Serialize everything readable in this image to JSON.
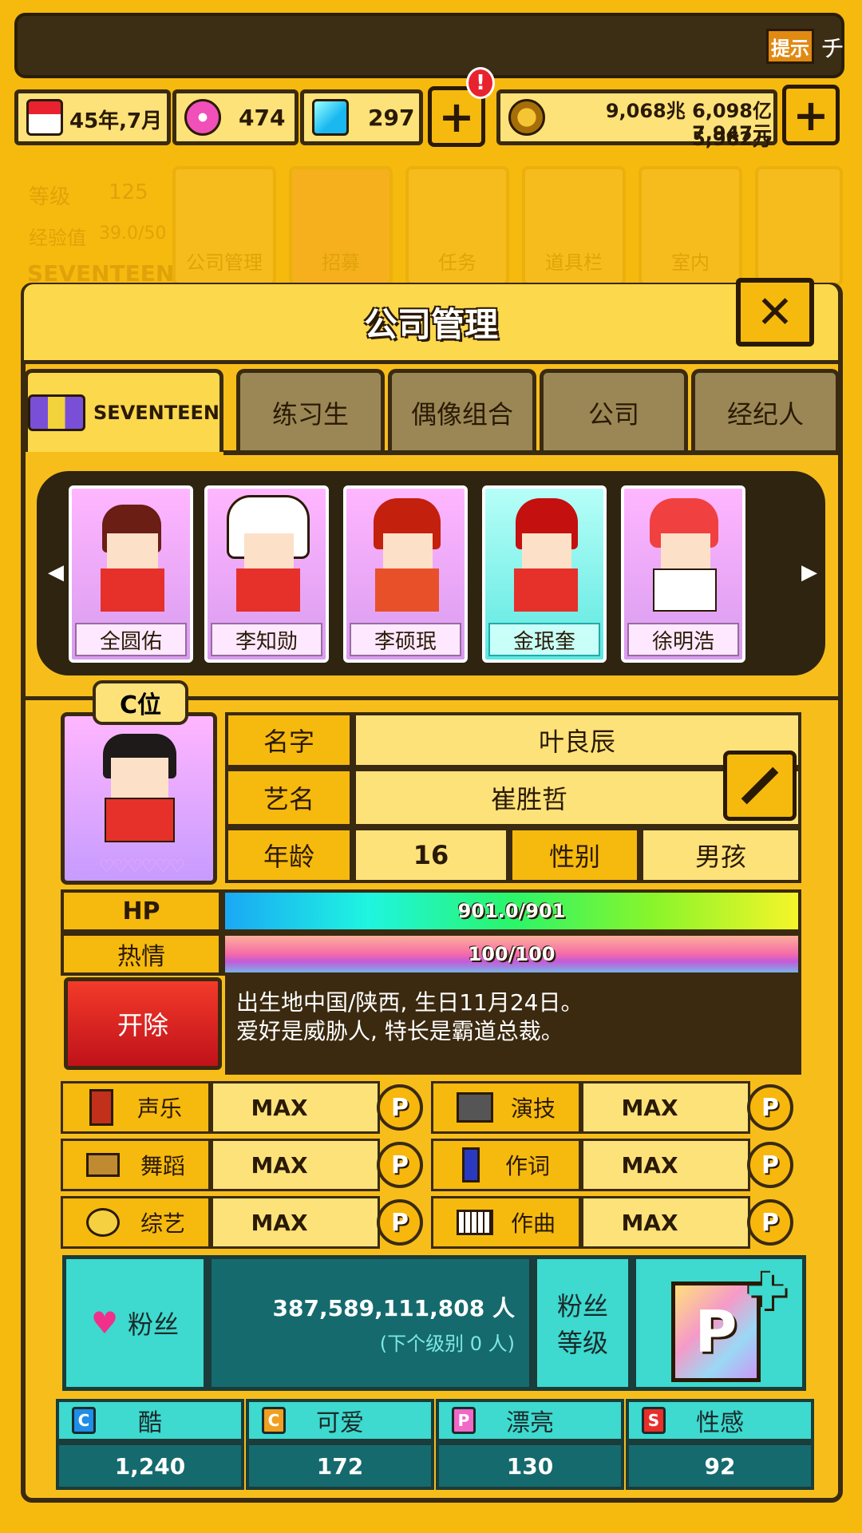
{
  "topbar": {
    "tip_label": "提示",
    "more_label": "チ",
    "date": "45年,7月",
    "gems_pink": "474",
    "gems_blue": "297",
    "money_line1": "9,068兆 6,098亿 5,962万",
    "money_line2": "7,947元",
    "alert_mark": "!"
  },
  "bg_menu": {
    "level_label": "等级",
    "level_value": "125",
    "exp_label": "经验值",
    "exp_value": "39.0/50",
    "group": "SEVENTEEN",
    "items": [
      "公司管理",
      "招募",
      "任务",
      "道具栏",
      "室内"
    ]
  },
  "panel": {
    "title": "公司管理",
    "close": "✕",
    "tabs": [
      "SEVENTEEN",
      "练习生",
      "偶像组合",
      "公司",
      "经纪人"
    ]
  },
  "members": [
    "全圆佑",
    "李知勋",
    "李硕珉",
    "金珉奎",
    "徐明浩"
  ],
  "profile": {
    "position": "C位",
    "name_label": "名字",
    "name_value": "叶良辰",
    "stage_label": "艺名",
    "stage_value": "崔胜哲",
    "age_label": "年龄",
    "age_value": "16",
    "gender_label": "性别",
    "gender_value": "男孩",
    "hearts": "♡♡♡♡♡♡",
    "hp_label": "HP",
    "hp_value": "901.0/901",
    "hp_fraction": 1.0,
    "passion_label": "热情",
    "passion_value": "100/100",
    "passion_fraction": 1.0,
    "fire_label": "开除",
    "bio_line1": "出生地中国/陕西, 生日11月24日。",
    "bio_line2": "爱好是威胁人, 特长是霸道总裁。"
  },
  "skills": [
    {
      "label": "声乐",
      "value": "MAX",
      "p": "P"
    },
    {
      "label": "演技",
      "value": "MAX",
      "p": "P"
    },
    {
      "label": "舞蹈",
      "value": "MAX",
      "p": "P"
    },
    {
      "label": "作词",
      "value": "MAX",
      "p": "P"
    },
    {
      "label": "综艺",
      "value": "MAX",
      "p": "P"
    },
    {
      "label": "作曲",
      "value": "MAX",
      "p": "P"
    }
  ],
  "fans": {
    "label": "粉丝",
    "count": "387,589,111,808 人",
    "next": "(下个级别 0 人)",
    "level_label_1": "粉丝",
    "level_label_2": "等级",
    "level_letter": "P"
  },
  "stats": [
    {
      "letter": "C",
      "label": "酷",
      "value": "1,240",
      "color": "#1e8ee8"
    },
    {
      "letter": "C",
      "label": "可爱",
      "value": "172",
      "color": "#f0a020"
    },
    {
      "letter": "P",
      "label": "漂亮",
      "value": "130",
      "color": "#f068c8"
    },
    {
      "letter": "S",
      "label": "性感",
      "value": "92",
      "color": "#e8302a"
    }
  ]
}
